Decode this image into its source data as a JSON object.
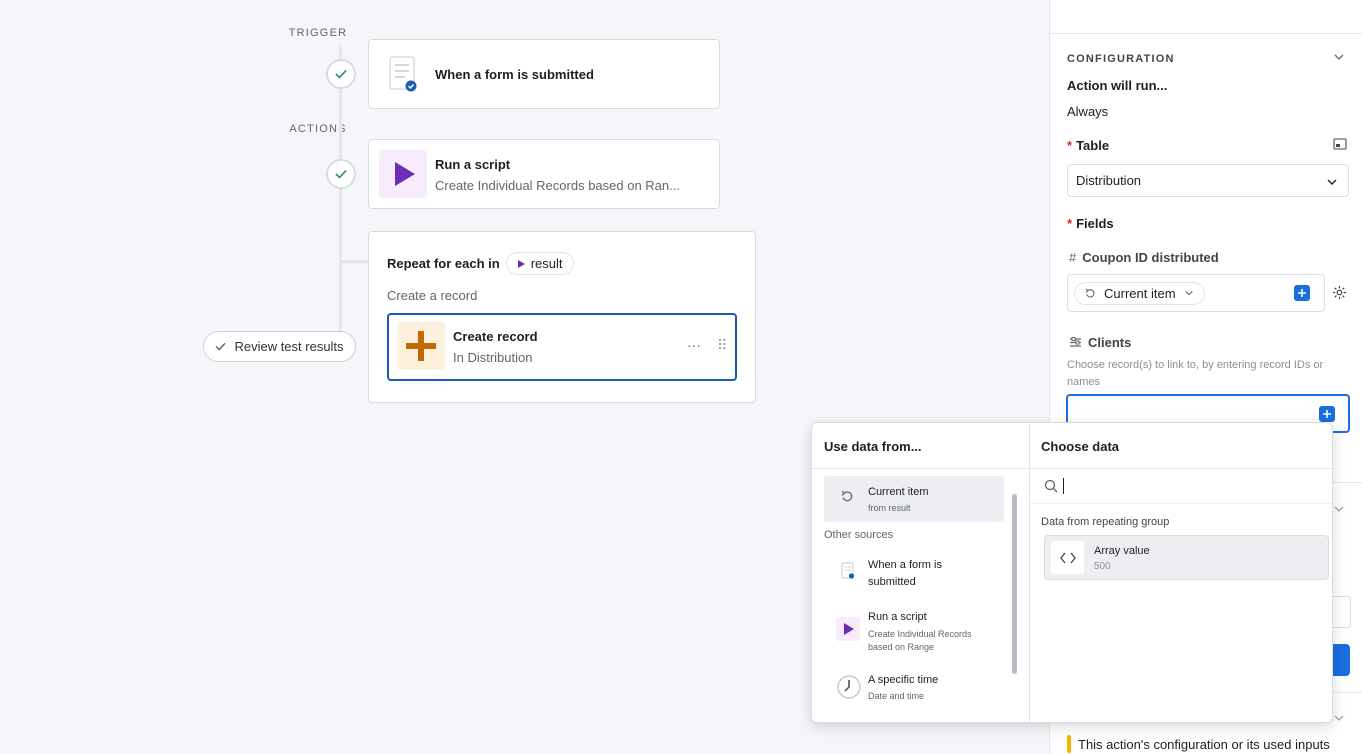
{
  "flow": {
    "trigger_label": "TRIGGER",
    "actions_label": "ACTIONS",
    "trigger_card": {
      "title": "When a form is submitted"
    },
    "script_card": {
      "title": "Run a script",
      "subtitle": "Create Individual Records based on Ran..."
    },
    "repeat": {
      "title": "Repeat for each in",
      "chip_label": "result",
      "subtitle": "Create a record",
      "inner_card": {
        "title": "Create record",
        "subtitle": "In Distribution",
        "more": "···",
        "drag": "⠿"
      }
    },
    "review_button": "Review test results"
  },
  "config": {
    "section_label": "CONFIGURATION",
    "run_label": "Action will run...",
    "run_value": "Always",
    "table_label": "Table",
    "table_value": "Distribution",
    "fields_label": "Fields",
    "required_mark": "*",
    "coupon_field_label": "Coupon ID distributed",
    "coupon_token": "Current item",
    "clients_label": "Clients",
    "clients_help": "Choose record(s) to link to, by entering record IDs or names",
    "warning_text": "This action's configuration or its used inputs"
  },
  "picker": {
    "left_header": "Use data from...",
    "right_header": "Choose data",
    "current_item": {
      "title": "Current item",
      "subtitle": "from result"
    },
    "other_sources_label": "Other sources",
    "sources": [
      {
        "title": "When a form is submitted",
        "subtitle": ""
      },
      {
        "title": "Run a script",
        "subtitle": "Create Individual Records based on Range"
      },
      {
        "title": "A specific time",
        "subtitle": "Date and time"
      }
    ],
    "search_value": "",
    "group_label": "Data from repeating group",
    "array_item": {
      "title": "Array value",
      "subtitle": "500"
    }
  },
  "colors": {
    "accent": "#1a6fe0",
    "script_purple": "#6b2fb3",
    "record_orange": "#c26a00",
    "warning_yellow": "#f5b400"
  }
}
